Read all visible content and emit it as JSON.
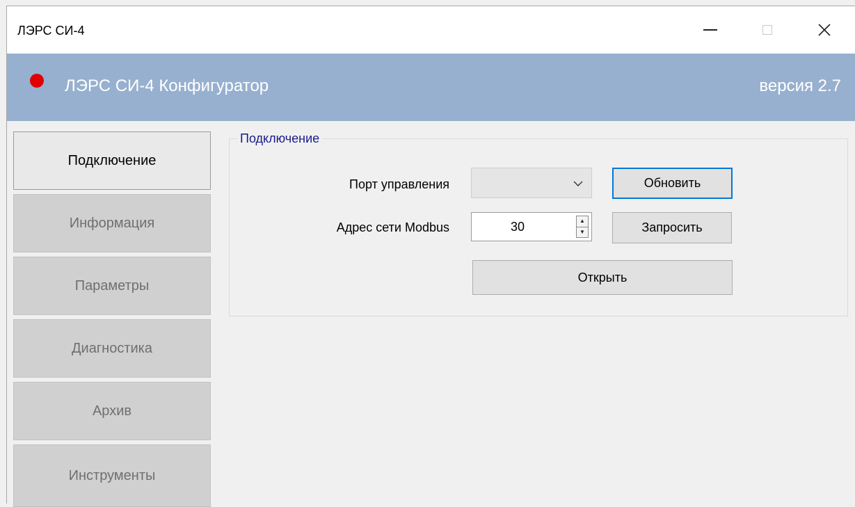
{
  "window": {
    "title": "ЛЭРС СИ-4",
    "minimize_glyph": "",
    "maximize_glyph": "",
    "close_glyph": "✕"
  },
  "header": {
    "app_title": "ЛЭРС СИ-4 Конфигуратор",
    "version": "версия 2.7",
    "status_color": "#e00000",
    "background": "#97b0cf"
  },
  "sidebar": {
    "items": [
      {
        "label": "Подключение",
        "active": true
      },
      {
        "label": "Информация",
        "active": false
      },
      {
        "label": "Параметры",
        "active": false
      },
      {
        "label": "Диагностика",
        "active": false
      },
      {
        "label": "Архив",
        "active": false
      },
      {
        "label": "Инструменты",
        "active": false
      }
    ]
  },
  "connection": {
    "group_title": "Подключение",
    "port_label": "Порт управления",
    "port_value": "",
    "refresh_button": "Обновить",
    "address_label": "Адрес сети Modbus",
    "address_value": "30",
    "query_button": "Запросить",
    "open_button": "Открыть"
  }
}
